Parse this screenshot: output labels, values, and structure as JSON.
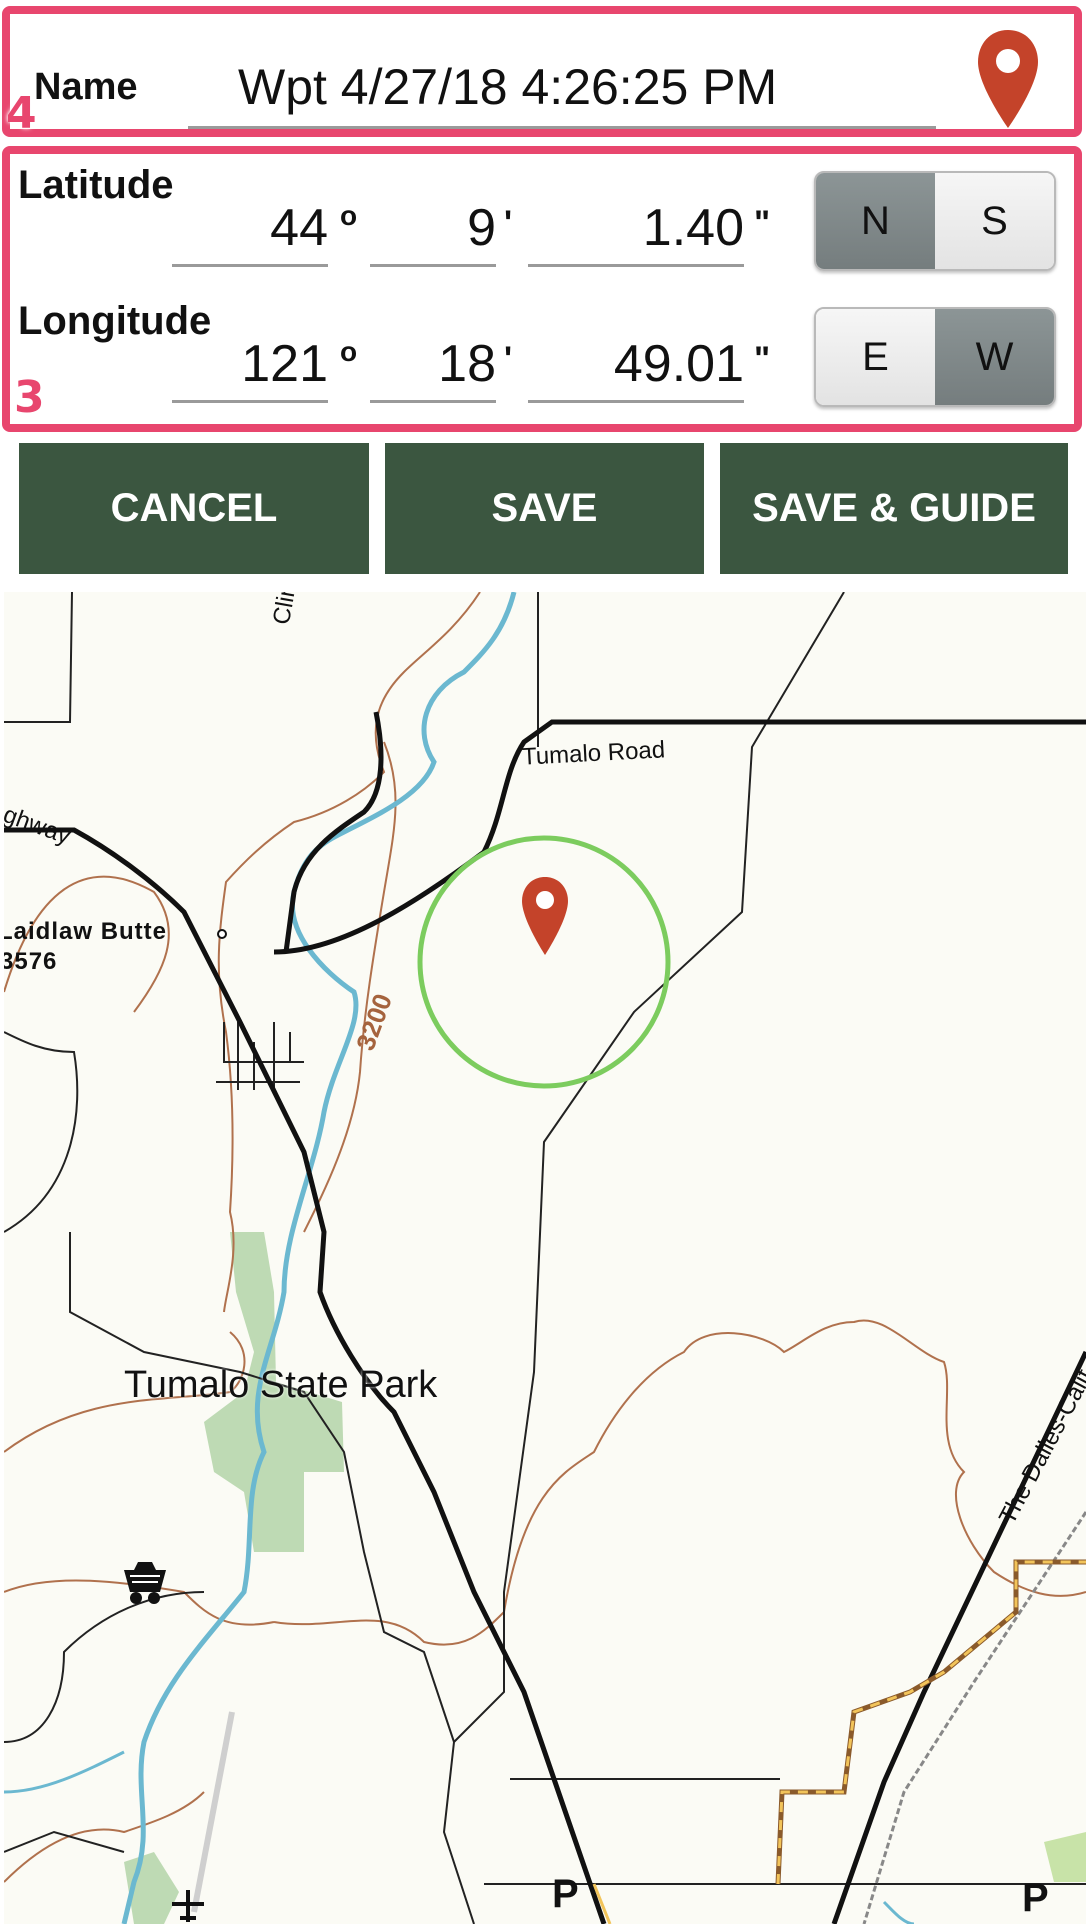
{
  "form": {
    "name_label": "Name",
    "name_value": "Wpt 4/27/18 4:26:25 PM",
    "latitude_label": "Latitude",
    "longitude_label": "Longitude",
    "latitude": {
      "deg": "44",
      "min": "9",
      "sec": "1.40",
      "hemisphere_options": [
        "N",
        "S"
      ],
      "selected": "N"
    },
    "longitude": {
      "deg": "121",
      "min": "18",
      "sec": "49.01",
      "hemisphere_options": [
        "E",
        "W"
      ],
      "selected": "W"
    },
    "deg_symbol": "o",
    "min_symbol": "'",
    "sec_symbol": "\""
  },
  "annotations": {
    "name_box": "4",
    "coords_box": "3"
  },
  "buttons": {
    "cancel": "CANCEL",
    "save": "SAVE",
    "save_guide": "SAVE & GUIDE"
  },
  "map": {
    "labels": {
      "tumalo_road": "Tumalo Road",
      "cline_falls": "Cline Falls Road",
      "highway": "ghway",
      "laidlaw": "Laidlaw Butte",
      "laidlaw_elev": "3576",
      "contour": "3200",
      "park": "Tumalo State Park",
      "dalles": "The Dalles-Calif",
      "parking1": "P",
      "parking2": "P"
    },
    "icons": [
      "map-pin-icon",
      "mine-cart-icon",
      "airport-icon",
      "parking-icon"
    ]
  },
  "colors": {
    "annotation": "#e8466e",
    "button": "#3b5640",
    "pin": "#c4432a",
    "accuracy_circle": "#7ccc5e",
    "river": "#6bb8d0",
    "contour": "#b0714d",
    "park": "#a9cf9d"
  }
}
